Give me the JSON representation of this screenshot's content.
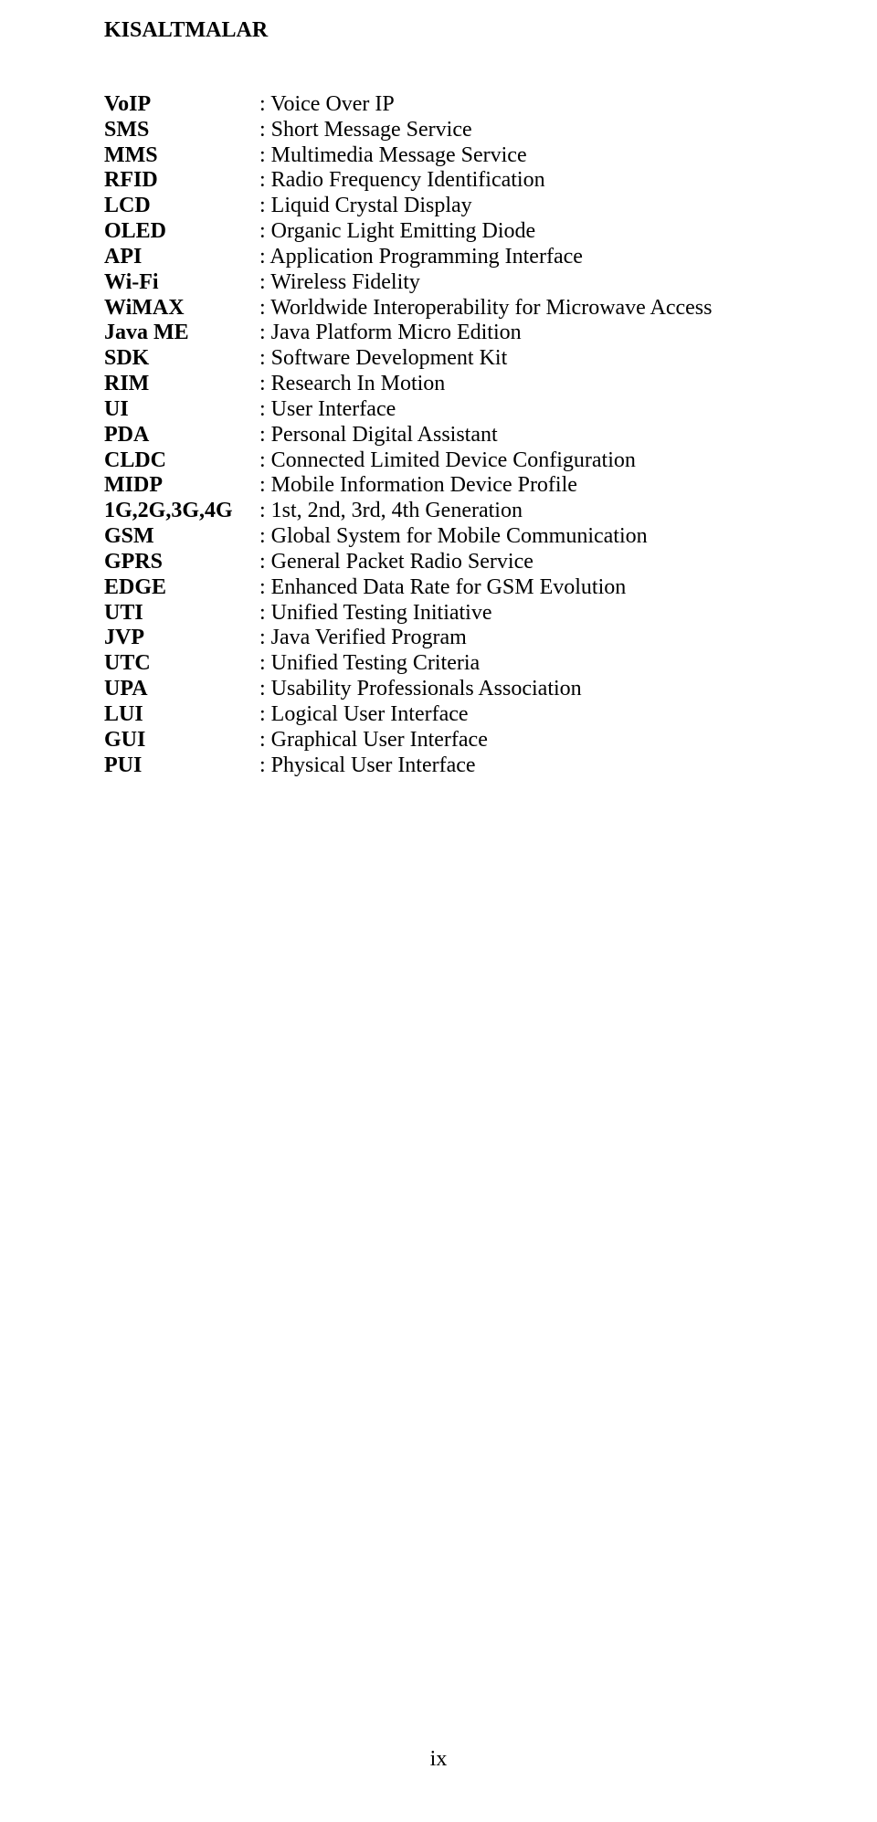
{
  "title": "KISALTMALAR",
  "entries": [
    {
      "abbr": "VoIP",
      "def": "Voice Over IP"
    },
    {
      "abbr": "SMS",
      "def": "Short Message Service"
    },
    {
      "abbr": "MMS",
      "def": "Multimedia Message Service"
    },
    {
      "abbr": "RFID",
      "def": "Radio Frequency Identification"
    },
    {
      "abbr": "LCD",
      "def": "Liquid Crystal Display"
    },
    {
      "abbr": "OLED",
      "def": "Organic Light Emitting Diode"
    },
    {
      "abbr": "API",
      "def": "Application Programming Interface"
    },
    {
      "abbr": "Wi-Fi",
      "def": "Wireless Fidelity"
    },
    {
      "abbr": "WiMAX",
      "def": "Worldwide Interoperability for Microwave Access"
    },
    {
      "abbr": "Java ME",
      "def": "Java Platform Micro Edition"
    },
    {
      "abbr": "SDK",
      "def": "Software Development Kit"
    },
    {
      "abbr": "RIM",
      "def": "Research In Motion"
    },
    {
      "abbr": "UI",
      "def": "User Interface"
    },
    {
      "abbr": "PDA",
      "def": "Personal Digital Assistant"
    },
    {
      "abbr": "CLDC",
      "def": "Connected Limited Device Configuration"
    },
    {
      "abbr": "MIDP",
      "def": "Mobile Information Device Profile"
    },
    {
      "abbr": "1G,2G,3G,4G",
      "def": "1st, 2nd, 3rd, 4th Generation"
    },
    {
      "abbr": "GSM",
      "def": "Global System for Mobile Communication"
    },
    {
      "abbr": "GPRS",
      "def": "General Packet Radio Service"
    },
    {
      "abbr": "EDGE",
      "def": "Enhanced Data Rate for GSM Evolution"
    },
    {
      "abbr": "UTI",
      "def": "Unified Testing Initiative"
    },
    {
      "abbr": "JVP",
      "def": "Java Verified Program"
    },
    {
      "abbr": "UTC",
      "def": "Unified Testing Criteria"
    },
    {
      "abbr": "UPA",
      "def": "Usability Professionals Association"
    },
    {
      "abbr": "LUI",
      "def": "Logical User Interface"
    },
    {
      "abbr": "GUI",
      "def": "Graphical User Interface"
    },
    {
      "abbr": "PUI",
      "def": "Physical User Interface"
    }
  ],
  "page_number": "ix"
}
